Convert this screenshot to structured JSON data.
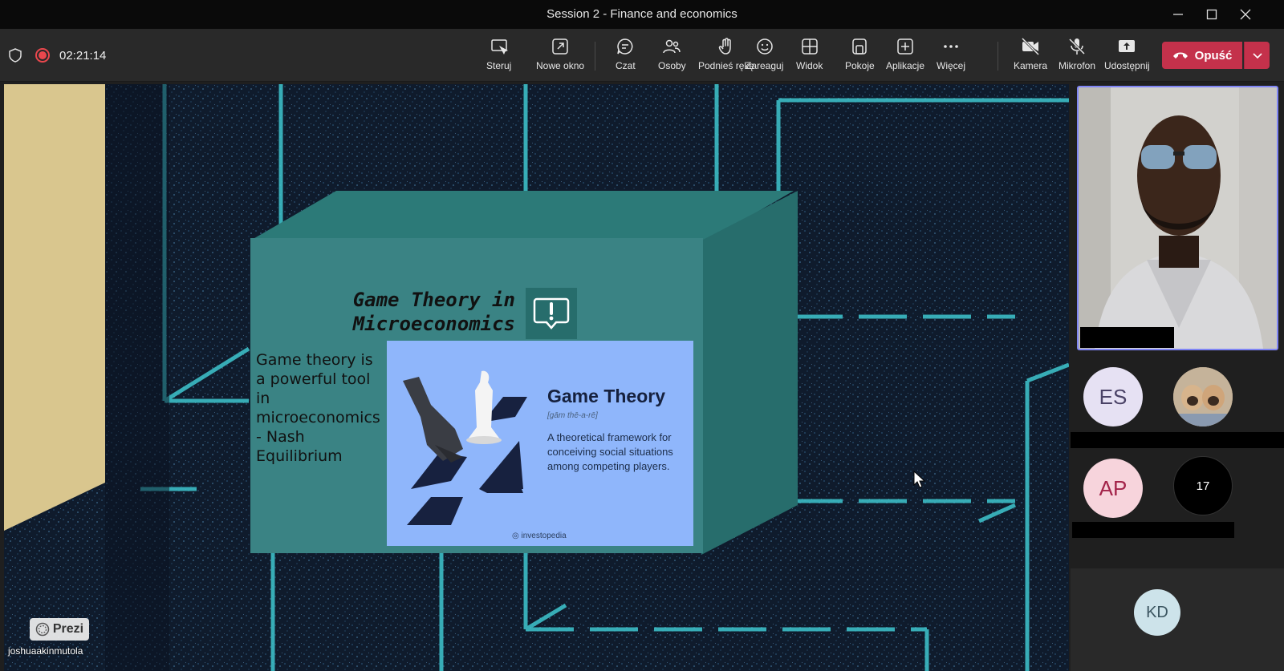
{
  "window": {
    "title": "Session 2 - Finance and economics",
    "controls": [
      "minimize-icon",
      "maximize-icon",
      "close-icon"
    ]
  },
  "toolbar": {
    "timer": "02:21:14",
    "buttons": [
      {
        "label": "Steruj",
        "icon": "control-icon"
      },
      {
        "label": "Nowe okno",
        "icon": "new-window-icon"
      },
      {
        "label": "Czat",
        "icon": "chat-icon"
      },
      {
        "label": "Osoby",
        "icon": "people-icon"
      },
      {
        "label": "Podnieś rękę",
        "icon": "raise-hand-icon"
      },
      {
        "label": "Zareaguj",
        "icon": "react-icon"
      },
      {
        "label": "Widok",
        "icon": "view-icon"
      },
      {
        "label": "Pokoje",
        "icon": "rooms-icon"
      },
      {
        "label": "Aplikacje",
        "icon": "apps-icon"
      },
      {
        "label": "Więcej",
        "icon": "more-icon"
      },
      {
        "label": "Kamera",
        "icon": "camera-off-icon"
      },
      {
        "label": "Mikrofon",
        "icon": "mic-off-icon"
      },
      {
        "label": "Udostępnij",
        "icon": "share-icon"
      }
    ],
    "leave_label": "Opuść"
  },
  "shared": {
    "slide_title": "Game Theory in Microeconomics",
    "slide_body": "Game theory is a powerful tool in microeconomics - Nash Equilibrium",
    "card": {
      "title": "Game Theory",
      "phonetic": "[gām thē-a-rē]",
      "description": "A theoretical framework for conceiving social situations among competing players.",
      "source": "investopedia"
    },
    "prezi_label": "Prezi",
    "sharer": "joshuaakinmutola"
  },
  "participants": {
    "es": {
      "initials": "ES",
      "bg": "#e6e1f3",
      "fg": "#4a4266"
    },
    "ap": {
      "initials": "AP",
      "bg": "#f7d4dc",
      "fg": "#a3244a"
    },
    "overflow": {
      "count": "17"
    },
    "kd": {
      "initials": "KD",
      "bg": "#cde3ea",
      "fg": "#3b5560"
    }
  },
  "colors": {
    "leave": "#c4314b",
    "recording": "#e9474d",
    "active_speaker": "#7f85f5"
  }
}
